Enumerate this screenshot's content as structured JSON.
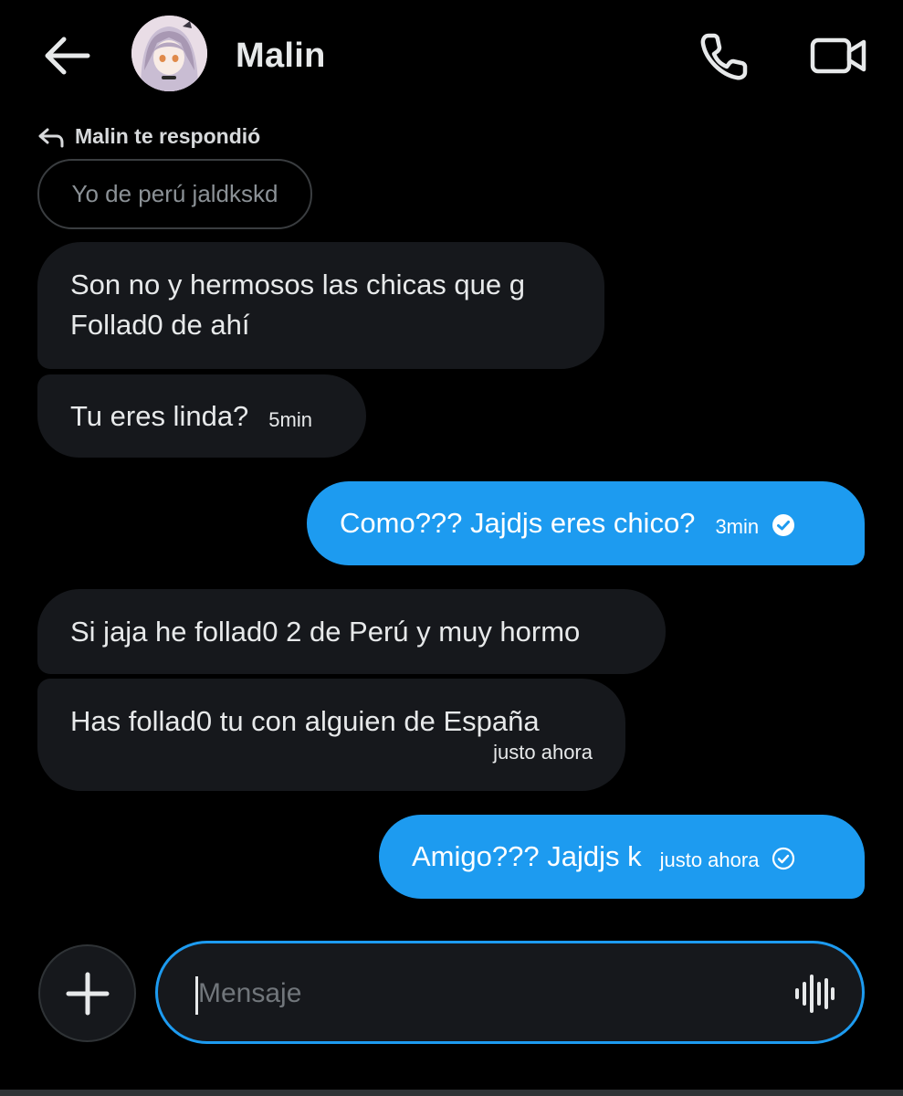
{
  "header": {
    "contact_name": "Malin",
    "back_icon": "arrow-left-icon",
    "call_icon": "phone-icon",
    "video_icon": "video-camera-icon"
  },
  "reply": {
    "label": "Malin te respondió",
    "quoted_text": "Yo de perú jaldkskd"
  },
  "messages": [
    {
      "direction": "in",
      "lines": [
        "Son no y hermosos las chicas que g",
        "Follad0 de ahí"
      ]
    },
    {
      "direction": "in",
      "text": "Tu eres linda?",
      "time": "5min"
    },
    {
      "direction": "out",
      "text": "Como??? Jajdjs eres chico?",
      "time": "3min",
      "status": "read"
    },
    {
      "direction": "in",
      "text": "Si jaja he follad0 2 de Perú y muy hormo"
    },
    {
      "direction": "in",
      "text": "Has follad0 tu con alguien de España",
      "time": "justo ahora"
    },
    {
      "direction": "out",
      "text": "Amigo??? Jajdjs k",
      "time": "justo ahora",
      "status": "sent"
    }
  ],
  "composer": {
    "placeholder": "Mensaje",
    "add_icon": "plus-icon",
    "voice_icon": "voice-waveform-icon"
  },
  "colors": {
    "background": "#000000",
    "incoming_bubble": "#16181c",
    "outgoing_bubble": "#1d9bf0",
    "accent": "#1d9bf0"
  }
}
